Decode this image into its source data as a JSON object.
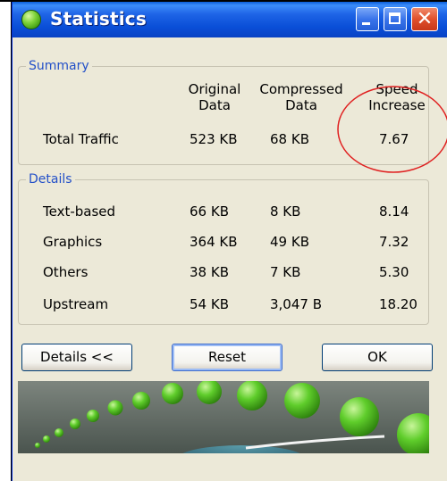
{
  "window": {
    "title": "Statistics",
    "icon": "green-ball-icon",
    "controls": {
      "minimize": "minimize-icon",
      "maximize": "maximize-icon",
      "close": "✕"
    }
  },
  "summary": {
    "legend": "Summary",
    "headers": {
      "original": [
        "Original",
        "Data"
      ],
      "compressed": [
        "Compressed",
        "Data"
      ],
      "speed": [
        "Speed",
        "Increase"
      ]
    },
    "total": {
      "label": "Total Traffic",
      "original": "523 KB",
      "compressed": "68 KB",
      "speed": "7.67"
    }
  },
  "details": {
    "legend": "Details",
    "rows": [
      {
        "label": "Text-based",
        "original": "66 KB",
        "compressed": "8 KB",
        "speed": "8.14"
      },
      {
        "label": "Graphics",
        "original": "364 KB",
        "compressed": "49 KB",
        "speed": "7.32"
      },
      {
        "label": "Others",
        "original": "38 KB",
        "compressed": "7 KB",
        "speed": "5.30"
      },
      {
        "label": "Upstream",
        "original": "54 KB",
        "compressed": "3,047 B",
        "speed": "18.20"
      }
    ]
  },
  "buttons": {
    "details": "Details <<",
    "reset": "Reset",
    "ok": "OK"
  },
  "colors": {
    "titlebar": "#0a4fd8",
    "dialog_bg": "#ece9d8",
    "group_legend": "#2350c8",
    "annotation_circle": "#e02020",
    "ball": "#59c928",
    "banner_bg": "#5f6a64"
  }
}
